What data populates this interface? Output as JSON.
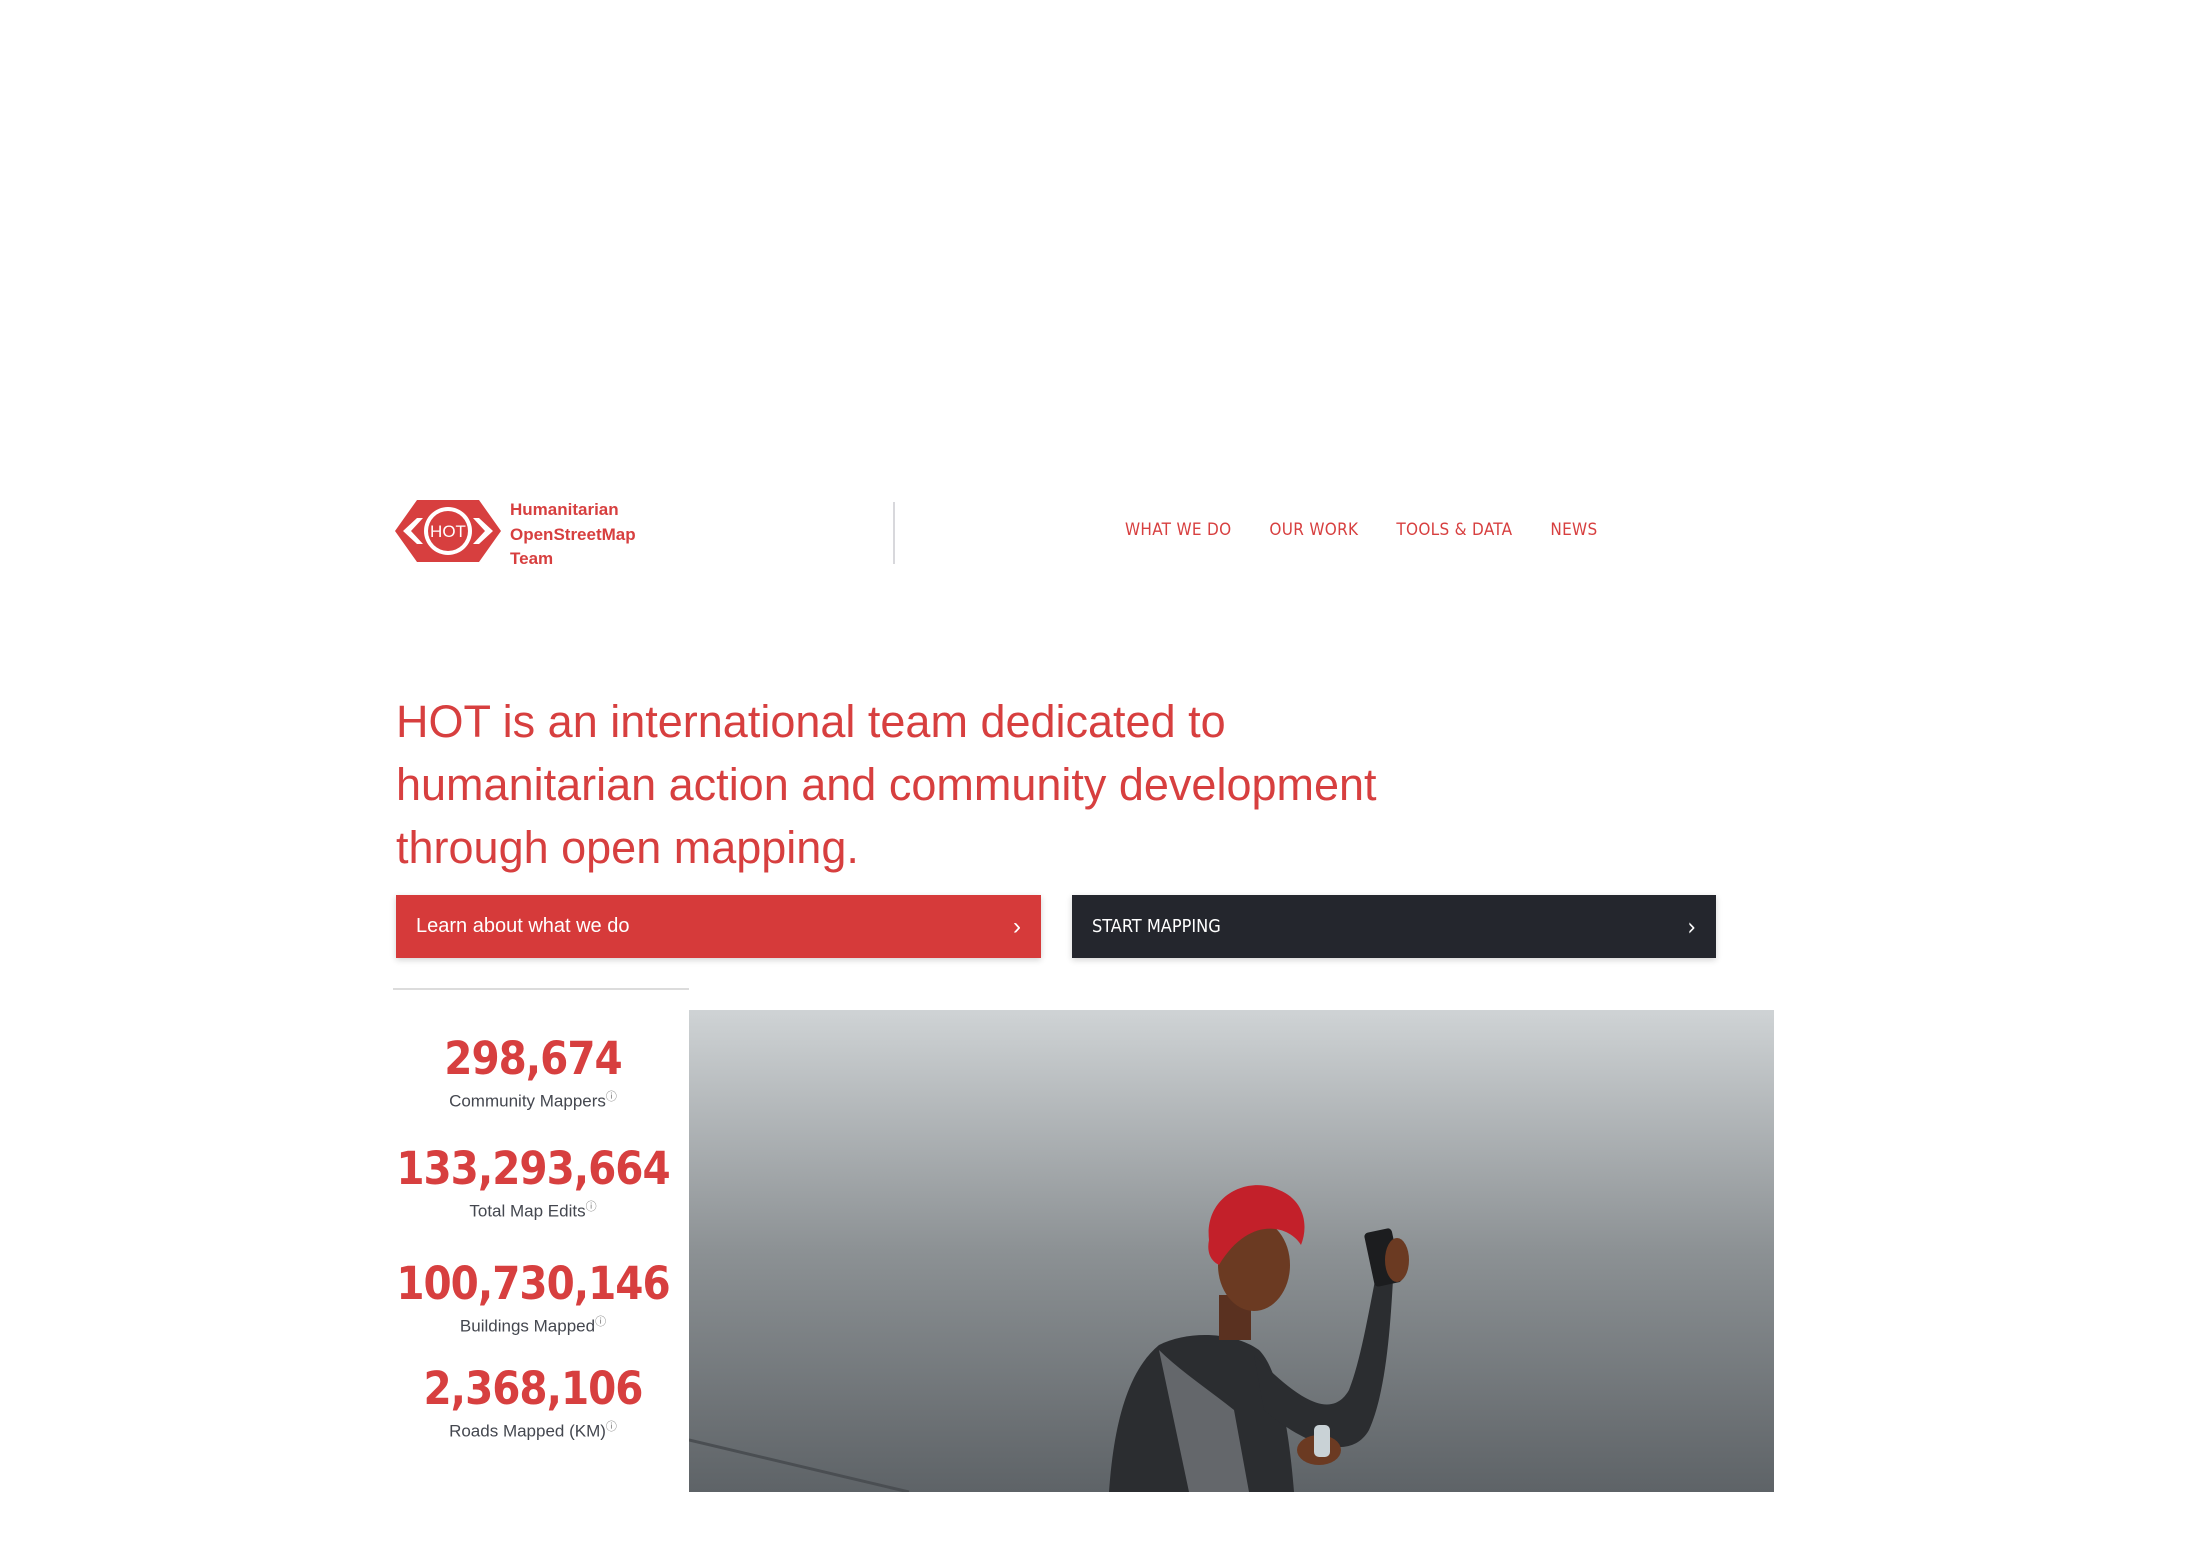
{
  "header": {
    "logo": {
      "mark_text": "HOT",
      "name_lines": [
        "Humanitarian",
        "OpenStreetMap",
        "Team"
      ]
    },
    "nav": [
      {
        "label": "WHAT WE DO"
      },
      {
        "label": "OUR WORK"
      },
      {
        "label": "TOOLS & DATA"
      },
      {
        "label": "NEWS"
      }
    ]
  },
  "hero": {
    "headline": "HOT is an international team dedicated to humanitarian action and community development through open mapping.",
    "primary_button": {
      "label": "Learn about what we do",
      "icon": "chevron-right-icon"
    },
    "secondary_button": {
      "label": "START MAPPING",
      "icon": "chevron-right-icon"
    },
    "image": {
      "description_icon": "photo-woman-holding-phone"
    }
  },
  "stats": [
    {
      "value": "298,674",
      "label": "Community Mappers"
    },
    {
      "value": "133,293,664",
      "label": "Total Map Edits"
    },
    {
      "value": "100,730,146",
      "label": "Buildings Mapped"
    },
    {
      "value": "2,368,106",
      "label": "Roads Mapped (KM)"
    }
  ],
  "stats_info_icon": "ⓘ",
  "colors": {
    "brand_red": "#d73f3f",
    "button_red": "#d63a3a",
    "button_dark": "#24262d",
    "stat_label": "#44474f"
  }
}
